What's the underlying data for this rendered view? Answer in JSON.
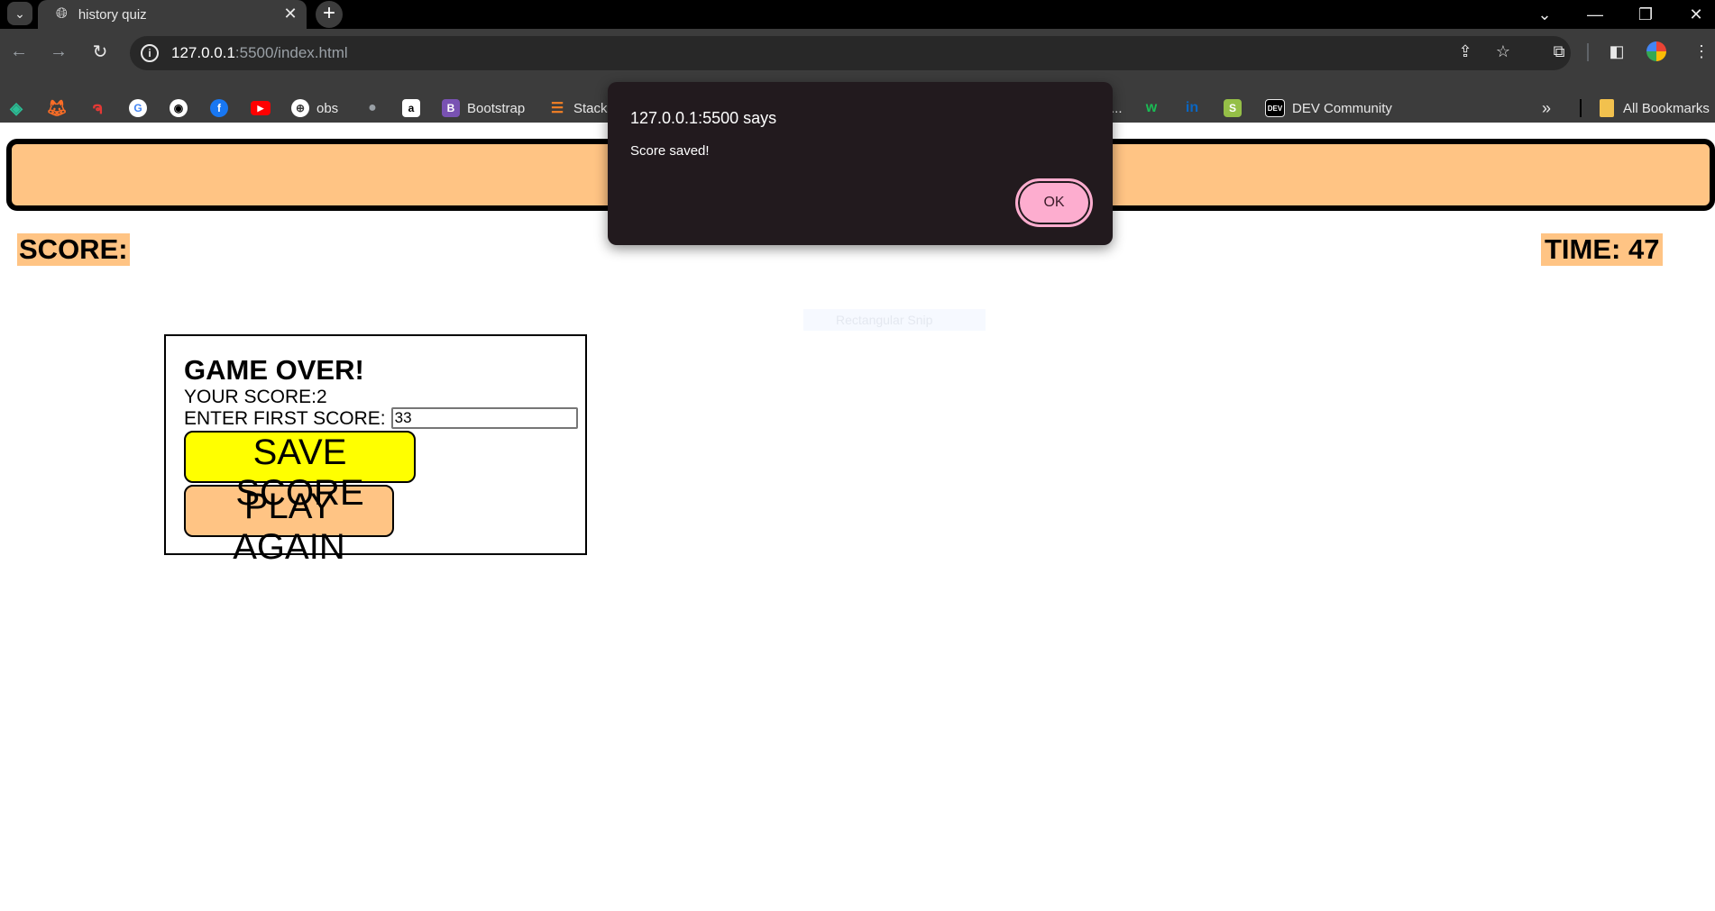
{
  "browser": {
    "tab_title": "history quiz",
    "tab_close": "✕",
    "new_tab": "+",
    "url_host": "127.0.0.1",
    "url_rest": ":5500/index.html",
    "bookmarks": [
      {
        "label": "",
        "icon": "codepen-like-icon",
        "color": "#2bbf96"
      },
      {
        "label": "",
        "icon": "gitlab-icon",
        "color": "#fc6d26"
      },
      {
        "label": "",
        "icon": "swirl-icon",
        "color": "#e53935"
      },
      {
        "label": "",
        "icon": "google-icon",
        "color": "#ffffff"
      },
      {
        "label": "",
        "icon": "github-icon",
        "color": "#ffffff"
      },
      {
        "label": "",
        "icon": "facebook-icon",
        "color": "#1877f2"
      },
      {
        "label": "",
        "icon": "youtube-icon",
        "color": "#ff0000"
      },
      {
        "label": "obs",
        "icon": "globe-icon",
        "color": "#ffffff"
      },
      {
        "label": "",
        "icon": "apple-icon",
        "color": "#9aa0a6"
      },
      {
        "label": "",
        "icon": "amazon-icon",
        "color": "#ffffff"
      },
      {
        "label": "Bootstrap",
        "icon": "bootstrap-icon",
        "color": "#7952b3"
      },
      {
        "label": "Stack",
        "icon": "stackoverflow-icon",
        "color": "#f48024"
      },
      {
        "label": "...",
        "icon": "",
        "color": ""
      },
      {
        "label": "",
        "icon": "w-icon",
        "color": "#1abc54"
      },
      {
        "label": "",
        "icon": "linkedin-icon",
        "color": "#0a66c2"
      },
      {
        "label": "",
        "icon": "shopify-icon",
        "color": "#95bf47"
      },
      {
        "label": "DEV Community",
        "icon": "dev-icon",
        "color": "#000000"
      }
    ],
    "overflow": "»",
    "all_bookmarks": "All Bookmarks"
  },
  "page": {
    "score_label": "SCORE:",
    "time_label": "TIME: 47",
    "snip_ghost": "Rectangular Snip",
    "game_over": {
      "title": "GAME OVER!",
      "your_score": "YOUR SCORE:2",
      "enter_label": "ENTER FIRST SCORE:",
      "input_value": "33",
      "save_button": "SAVE SCORE",
      "play_button": "PLAY AGAIN"
    }
  },
  "alert": {
    "title": "127.0.0.1:5500 says",
    "message": "Score saved!",
    "ok": "OK"
  },
  "colors": {
    "header_bg": "#ffc484",
    "save_bg": "#ffff00",
    "play_bg": "#ffc484",
    "alert_bg": "#221a1e",
    "ok_bg": "#fdadcf"
  }
}
